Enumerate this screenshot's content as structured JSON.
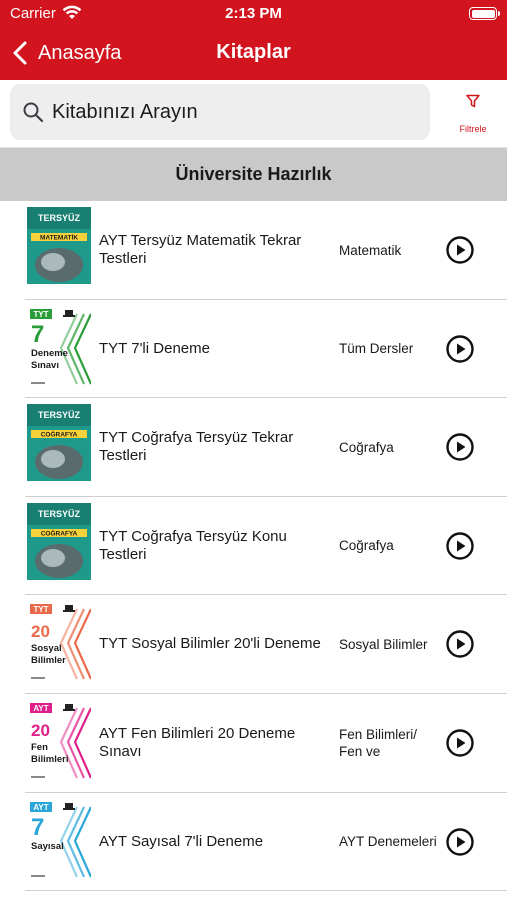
{
  "status_bar": {
    "carrier": "Carrier",
    "time": "2:13 PM"
  },
  "nav": {
    "back_label": "Anasayfa",
    "title": "Kitaplar"
  },
  "search": {
    "placeholder": "Kitabınızı Arayın",
    "value": ""
  },
  "filter": {
    "label": "Filtrele"
  },
  "section": {
    "title": "Üniversite Hazırlık"
  },
  "colors": {
    "brand_red": "#d1141d",
    "section_gray": "#c9c9c9"
  },
  "books": [
    {
      "title": "AYT Tersyüz Matematik Tekrar Testleri",
      "subject": "Matematik",
      "cover": {
        "style": "tersyuz",
        "label": "MATEMATİK",
        "color": "#1f9a8a"
      }
    },
    {
      "title": "TYT 7'li Deneme",
      "subject": "Tüm Dersler",
      "cover": {
        "style": "deneme",
        "tag": "TYT",
        "number": "7",
        "words": [
          "Deneme",
          "Sınavı"
        ],
        "color": "#2a9d3a"
      }
    },
    {
      "title": "TYT Coğrafya Tersyüz Tekrar Testleri",
      "subject": "Coğrafya",
      "cover": {
        "style": "tersyuz",
        "label": "COĞRAFYA",
        "color": "#1f9a8a"
      }
    },
    {
      "title": "TYT Coğrafya Tersyüz Konu Testleri",
      "subject": "Coğrafya",
      "cover": {
        "style": "tersyuz",
        "label": "COĞRAFYA",
        "color": "#1f9a8a"
      }
    },
    {
      "title": "TYT Sosyal Bilimler 20'li Deneme",
      "subject": "Sosyal Bilimler",
      "cover": {
        "style": "deneme",
        "tag": "TYT",
        "number": "20",
        "words": [
          "Sosyal",
          "Bilimler"
        ],
        "color": "#e86a4a"
      }
    },
    {
      "title": "AYT Fen Bilimleri 20 Deneme Sınavı",
      "subject": "Fen Bilimleri/ Fen ve",
      "cover": {
        "style": "deneme",
        "tag": "AYT",
        "number": "20",
        "words": [
          "Fen",
          "Bilimleri"
        ],
        "color": "#e0208a"
      }
    },
    {
      "title": "AYT Sayısal 7'li Deneme",
      "subject": "AYT Denemeleri",
      "cover": {
        "style": "deneme",
        "tag": "AYT",
        "number": "7",
        "words": [
          "Sayısal"
        ],
        "color": "#2aa7d8"
      }
    }
  ]
}
